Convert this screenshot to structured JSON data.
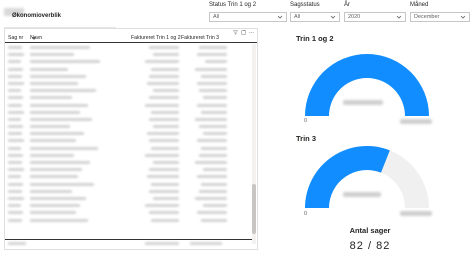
{
  "report": {
    "title": "Økonomioverblik"
  },
  "slicers": [
    {
      "label": "Status Trin 1 og 2",
      "value": "All"
    },
    {
      "label": "Sagsstatus",
      "value": "All"
    },
    {
      "label": "År",
      "value": "2020"
    },
    {
      "label": "Måned",
      "value": "December"
    }
  ],
  "table": {
    "columns": [
      "Sag nr",
      "Navn",
      "Faktureret Trin 1 og 2",
      "Faktureret Trin 3"
    ],
    "row_count": 25
  },
  "gauges": [
    {
      "title": "Trin 1 og 2",
      "min_label": "0",
      "fill_fraction": 1.0,
      "fill_color": "#118dff",
      "track_color": "#f0f0f0"
    },
    {
      "title": "Trin 3",
      "min_label": "0",
      "fill_fraction": 0.62,
      "fill_color": "#118dff",
      "track_color": "#f0f0f0"
    }
  ],
  "count_card": {
    "title": "Antal sager",
    "value": "82  /  82"
  },
  "icons": {
    "filter": "filter-icon",
    "focus": "focus-mode-icon",
    "more": "more-options-icon",
    "chevron": "chevron-down-icon"
  }
}
